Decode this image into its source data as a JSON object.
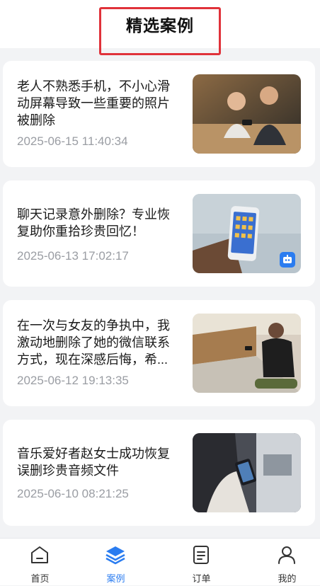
{
  "header": {
    "title": "精选案例"
  },
  "cases": [
    {
      "title": "老人不熟悉手机，不小心滑动屏幕导致一些重要的照片被删除",
      "date": "2025-06-15 11:40:34",
      "image": "elderly-couple-phone-photo"
    },
    {
      "title": "聊天记录意外删除？专业恢复助你重拾珍贵回忆！",
      "date": "2025-06-13 17:02:17",
      "image": "hand-holding-phone-photo"
    },
    {
      "title": "在一次与女友的争执中，我激动地删除了她的微信联系方式，现在深感后悔，希...",
      "date": "2025-06-12 19:13:35",
      "image": "man-on-platform-phone-photo"
    },
    {
      "title": "音乐爱好者赵女士成功恢复误删珍贵音频文件",
      "date": "2025-06-10 08:21:25",
      "image": "woman-using-phone-photo"
    }
  ],
  "tabbar": {
    "items": [
      {
        "label": "首页",
        "icon": "home-icon"
      },
      {
        "label": "案例",
        "icon": "layers-icon",
        "active": true
      },
      {
        "label": "订单",
        "icon": "order-icon"
      },
      {
        "label": "我的",
        "icon": "user-icon"
      }
    ]
  },
  "colors": {
    "accent": "#2a7cf0",
    "highlight": "#e0323a",
    "date": "#9a9da3"
  }
}
